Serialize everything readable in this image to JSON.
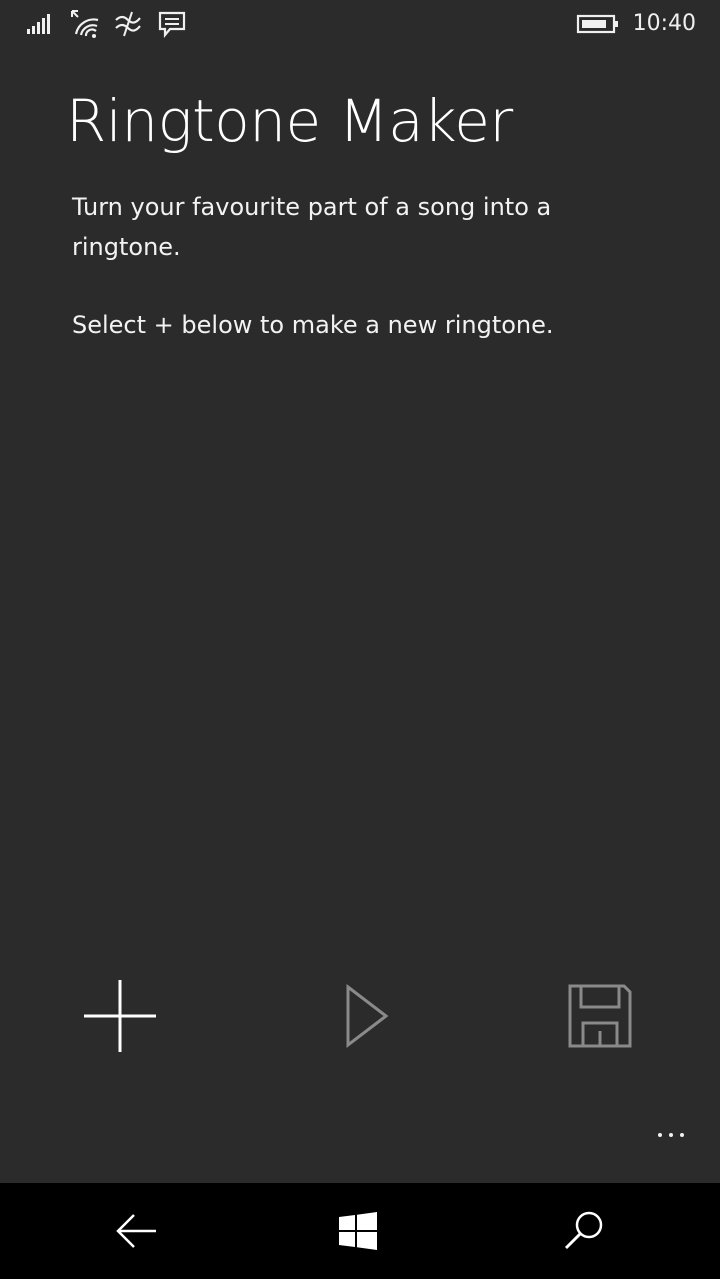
{
  "status_bar": {
    "time": "10:40",
    "icons": [
      "signal-strength-icon",
      "wifi-icon",
      "data-sense-icon",
      "message-icon",
      "battery-icon"
    ]
  },
  "main": {
    "title": "Ringtone Maker",
    "description": "Turn your favourite part of a song into a ringtone.",
    "instruction": "Select + below to make a new ringtone."
  },
  "app_bar": {
    "buttons": [
      {
        "icon": "plus-icon",
        "enabled": true
      },
      {
        "icon": "play-icon",
        "enabled": false
      },
      {
        "icon": "save-icon",
        "enabled": false
      }
    ],
    "more_icon": "more-dots-icon"
  },
  "nav_bar": {
    "buttons": [
      "back-arrow-icon",
      "windows-logo-icon",
      "search-icon"
    ]
  },
  "colors": {
    "background": "#2b2b2b",
    "nav_background": "#000000",
    "text": "#ffffff",
    "disabled": "#8a8a8a"
  }
}
